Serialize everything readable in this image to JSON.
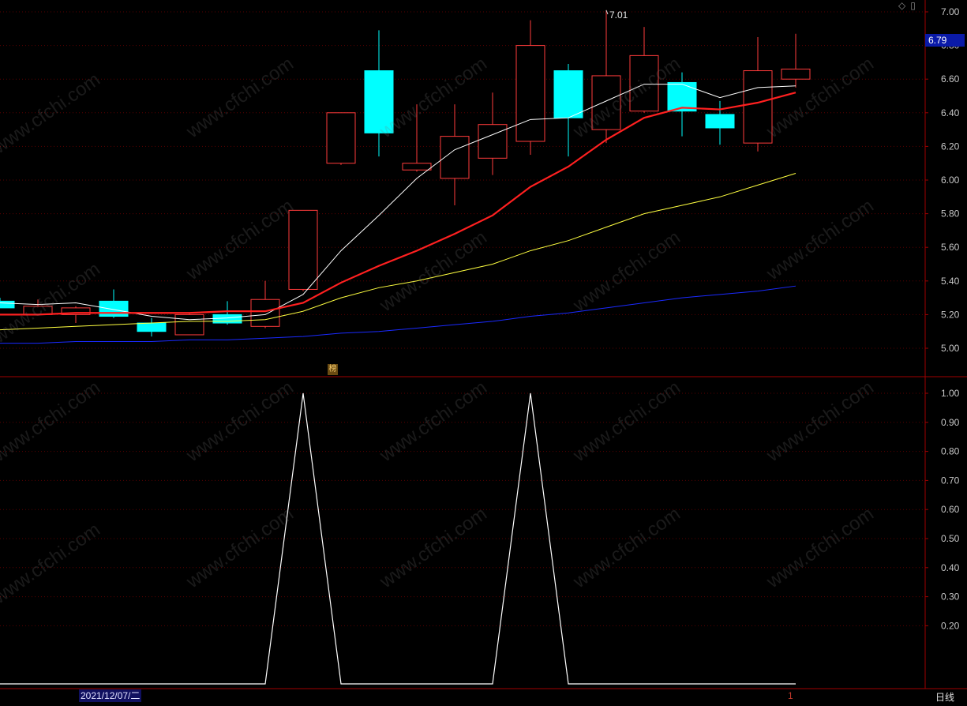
{
  "chart_data": [
    {
      "type": "candlestick",
      "ylim": [
        4.85,
        7.02
      ],
      "y_ticks": [
        "7.00",
        "6.80",
        "6.60",
        "6.40",
        "6.20",
        "6.00",
        "5.80",
        "5.60",
        "5.40",
        "5.20",
        "5.00"
      ],
      "candles": [
        {
          "o": 5.28,
          "h": 5.3,
          "l": 5.24,
          "c": 5.24
        },
        {
          "o": 5.2,
          "h": 5.29,
          "l": 5.2,
          "c": 5.25
        },
        {
          "o": 5.2,
          "h": 5.25,
          "l": 5.15,
          "c": 5.24
        },
        {
          "o": 5.28,
          "h": 5.35,
          "l": 5.18,
          "c": 5.19
        },
        {
          "o": 5.15,
          "h": 5.18,
          "l": 5.07,
          "c": 5.1
        },
        {
          "o": 5.08,
          "h": 5.21,
          "l": 5.08,
          "c": 5.2
        },
        {
          "o": 5.2,
          "h": 5.28,
          "l": 5.14,
          "c": 5.15
        },
        {
          "o": 5.13,
          "h": 5.4,
          "l": 5.12,
          "c": 5.29
        },
        {
          "o": 5.35,
          "h": 5.82,
          "l": 5.34,
          "c": 5.82
        },
        {
          "o": 6.1,
          "h": 6.4,
          "l": 6.09,
          "c": 6.4
        },
        {
          "o": 6.65,
          "h": 6.89,
          "l": 6.14,
          "c": 6.28
        },
        {
          "o": 6.06,
          "h": 6.45,
          "l": 6.05,
          "c": 6.1
        },
        {
          "o": 6.01,
          "h": 6.45,
          "l": 5.85,
          "c": 6.26
        },
        {
          "o": 6.13,
          "h": 6.52,
          "l": 6.03,
          "c": 6.33
        },
        {
          "o": 6.23,
          "h": 6.95,
          "l": 6.15,
          "c": 6.8
        },
        {
          "o": 6.65,
          "h": 6.69,
          "l": 6.14,
          "c": 6.37
        },
        {
          "o": 6.3,
          "h": 7.01,
          "l": 6.22,
          "c": 6.62
        },
        {
          "o": 6.41,
          "h": 6.91,
          "l": 6.4,
          "c": 6.74
        },
        {
          "o": 6.58,
          "h": 6.64,
          "l": 6.26,
          "c": 6.41
        },
        {
          "o": 6.39,
          "h": 6.47,
          "l": 6.21,
          "c": 6.31
        },
        {
          "o": 6.22,
          "h": 6.85,
          "l": 6.17,
          "c": 6.65
        },
        {
          "o": 6.6,
          "h": 6.87,
          "l": 6.55,
          "c": 6.66
        }
      ],
      "series": [
        {
          "color": "#ffffff",
          "width": 1,
          "values": [
            5.27,
            5.26,
            5.27,
            5.23,
            5.19,
            5.17,
            5.18,
            5.2,
            5.32,
            5.58,
            5.79,
            6.01,
            6.18,
            6.27,
            6.36,
            6.37,
            6.47,
            6.57,
            6.57,
            6.49,
            6.55,
            6.56
          ]
        },
        {
          "color": "#ff2020",
          "width": 2.2,
          "values": [
            5.2,
            5.2,
            5.21,
            5.21,
            5.21,
            5.21,
            5.22,
            5.22,
            5.27,
            5.39,
            5.49,
            5.58,
            5.68,
            5.79,
            5.96,
            6.08,
            6.24,
            6.37,
            6.43,
            6.42,
            6.46,
            6.52
          ]
        },
        {
          "color": "#ffff40",
          "width": 1,
          "values": [
            5.11,
            5.12,
            5.13,
            5.14,
            5.15,
            5.16,
            5.16,
            5.17,
            5.22,
            5.3,
            5.36,
            5.4,
            5.45,
            5.5,
            5.58,
            5.64,
            5.72,
            5.8,
            5.85,
            5.9,
            5.97,
            6.04
          ]
        },
        {
          "color": "#1a2aff",
          "width": 1,
          "values": [
            5.03,
            5.03,
            5.04,
            5.04,
            5.04,
            5.05,
            5.05,
            5.06,
            5.07,
            5.09,
            5.1,
            5.12,
            5.14,
            5.16,
            5.19,
            5.21,
            5.24,
            5.27,
            5.3,
            5.32,
            5.34,
            5.37
          ]
        }
      ]
    },
    {
      "type": "line",
      "ylim": [
        0.0,
        1.03
      ],
      "y_ticks": [
        "1.00",
        "0.90",
        "0.80",
        "0.70",
        "0.60",
        "0.50",
        "0.40",
        "0.30",
        "0.20"
      ],
      "series": [
        {
          "color": "#ffffff",
          "width": 1.2,
          "values": [
            0,
            0,
            0,
            0,
            0,
            0,
            0,
            0,
            1,
            0,
            0,
            0,
            0,
            0,
            1,
            0,
            0,
            0,
            0,
            0,
            0,
            0
          ]
        }
      ]
    }
  ],
  "labels": {
    "current_price": "6.79",
    "high_marker": "7.01",
    "date": "2021/12/07/二",
    "period": "日线",
    "badge": "榜",
    "cursor": "1"
  },
  "colors": {
    "up": "#ff3b3b",
    "down": "#00ffff",
    "axis": "#a00000",
    "grid": "#5a0000"
  },
  "watermark": "www.cfchi.com"
}
